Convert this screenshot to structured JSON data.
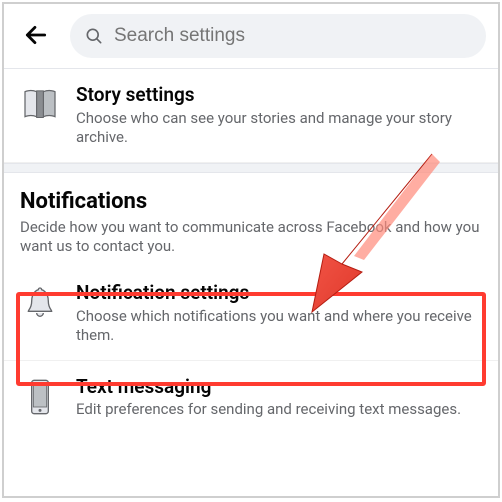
{
  "search": {
    "placeholder": "Search settings"
  },
  "story": {
    "title": "Story settings",
    "sub": "Choose who can see your stories and manage your story archive."
  },
  "notifications_section": {
    "title": "Notifications",
    "sub": "Decide how you want to communicate across Facebook and how you want us to contact you."
  },
  "notification_settings": {
    "title": "Notification settings",
    "sub": "Choose which notifications you want and where you receive them."
  },
  "text_messaging": {
    "title": "Text messaging",
    "sub": "Edit preferences for sending and receiving text messages."
  }
}
